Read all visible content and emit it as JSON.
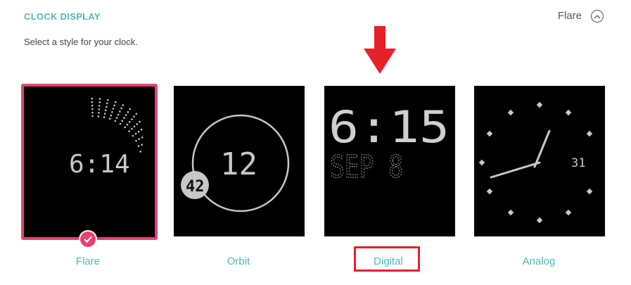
{
  "header": {
    "title": "CLOCK DISPLAY",
    "subtitle": "Select a style for your clock.",
    "selected_value": "Flare"
  },
  "clocks": [
    {
      "label": "Flare",
      "time": "6:14",
      "selected": true
    },
    {
      "label": "Orbit",
      "center_value": "12",
      "badge_value": "42",
      "selected": false
    },
    {
      "label": "Digital",
      "time": "6:15",
      "date": "SEP 8",
      "selected": false
    },
    {
      "label": "Analog",
      "date_value": "31",
      "selected": false
    }
  ],
  "colors": {
    "accent": "#4fb8b8",
    "selection": "#e8416f",
    "annotation": "#e8202a"
  }
}
